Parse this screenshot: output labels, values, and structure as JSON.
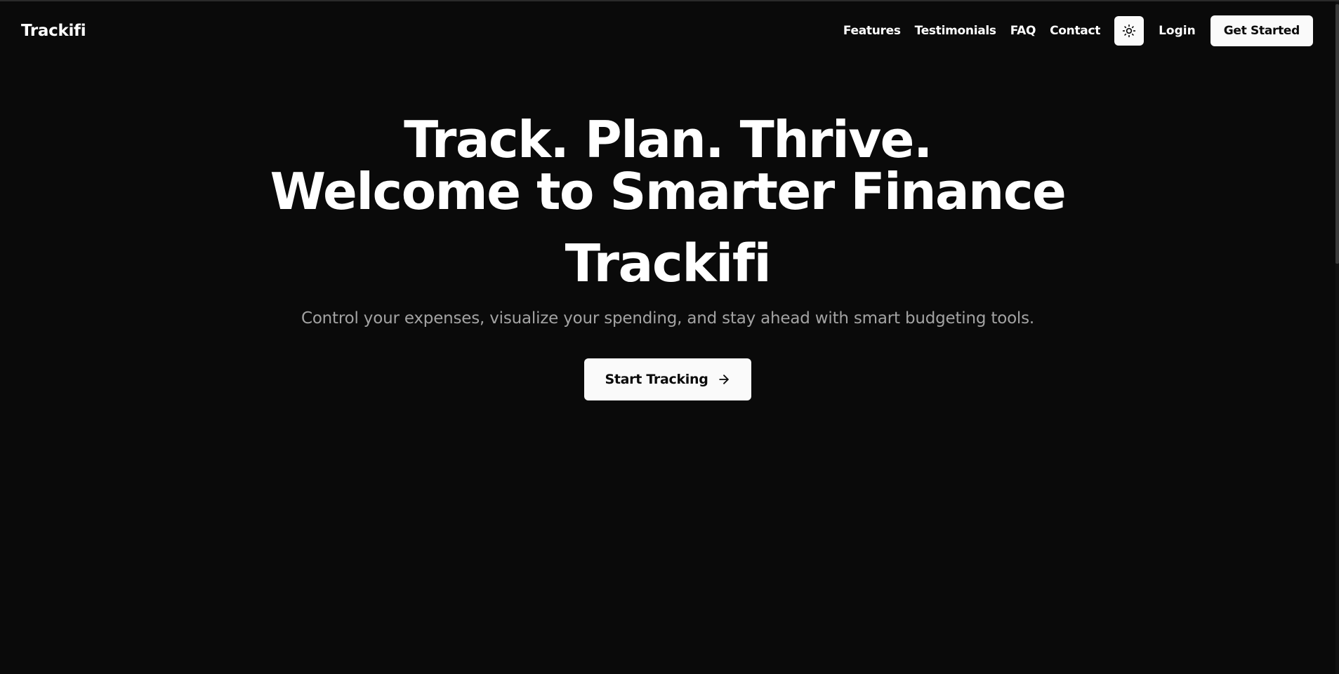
{
  "header": {
    "logo": "Trackifi",
    "nav": [
      "Features",
      "Testimonials",
      "FAQ",
      "Contact"
    ],
    "theme_toggle_icon": "sun-icon",
    "login_label": "Login",
    "get_started_label": "Get Started"
  },
  "hero": {
    "headline_line1": "Track. Plan. Thrive.",
    "headline_line2": "Welcome to Smarter Finance",
    "brand": "Trackifi",
    "tagline": "Control your expenses, visualize your spending, and stay ahead with smart budgeting tools.",
    "cta_label": "Start Tracking",
    "cta_icon": "arrow-right-icon"
  },
  "colors": {
    "background": "#0a0a0a",
    "foreground": "#ffffff",
    "muted": "#a3a3a3",
    "button_bg": "#fafafa",
    "button_fg": "#0a0a0a"
  }
}
